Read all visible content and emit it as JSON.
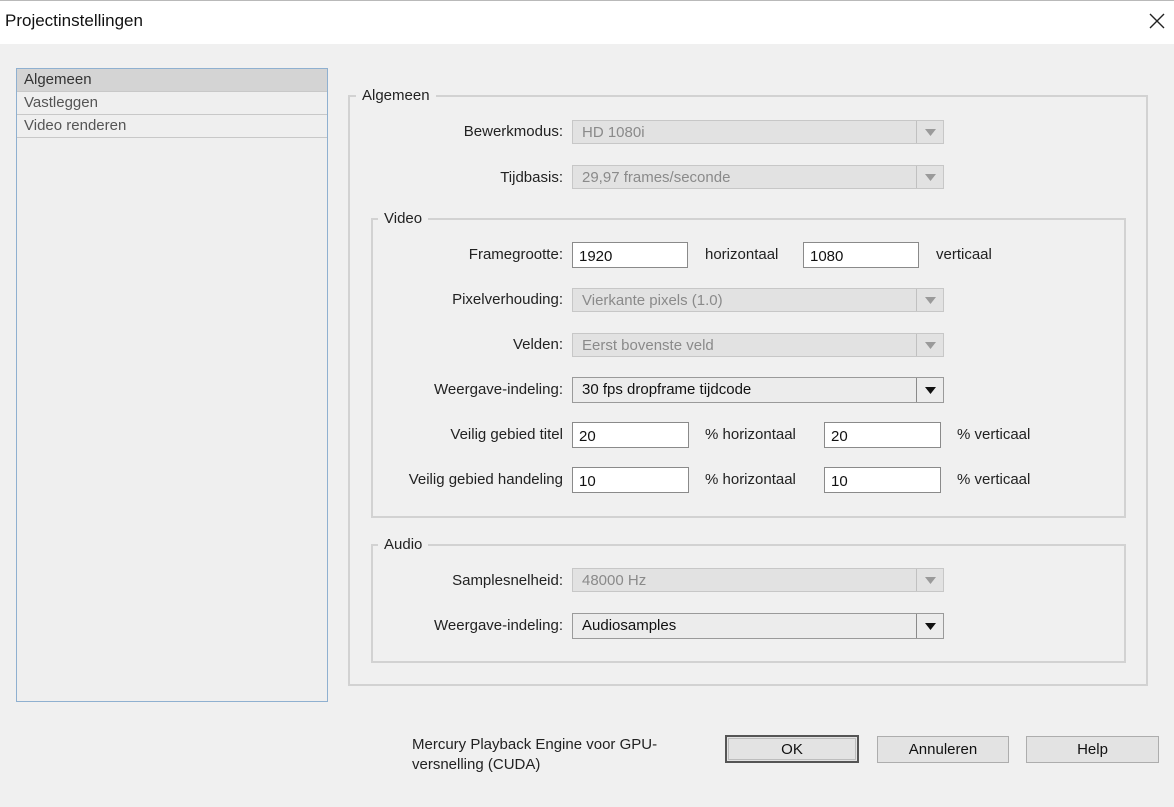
{
  "window": {
    "title": "Projectinstellingen",
    "close_icon": "close-icon"
  },
  "sidebar": {
    "items": [
      {
        "label": "Algemeen",
        "selected": true
      },
      {
        "label": "Vastleggen",
        "selected": false
      },
      {
        "label": "Video renderen",
        "selected": false
      }
    ]
  },
  "general": {
    "legend": "Algemeen",
    "edit_mode": {
      "label": "Bewerkmodus:",
      "value": "HD 1080i",
      "enabled": false
    },
    "timebase": {
      "label": "Tijdbasis:",
      "value": "29,97 frames/seconde",
      "enabled": false
    }
  },
  "video": {
    "legend": "Video",
    "frame_size": {
      "label": "Framegrootte:",
      "horizontal": "1920",
      "horizontal_label": "horizontaal",
      "vertical": "1080",
      "vertical_label": "verticaal"
    },
    "pixel_aspect": {
      "label": "Pixelverhouding:",
      "value": "Vierkante pixels (1.0)",
      "enabled": false
    },
    "fields": {
      "label": "Velden:",
      "value": "Eerst bovenste veld",
      "enabled": false
    },
    "display_format": {
      "label": "Weergave-indeling:",
      "value": "30 fps dropframe tijdcode",
      "enabled": true
    },
    "title_safe": {
      "label": "Veilig gebied titel",
      "horizontal": "20",
      "horizontal_label": "% horizontaal",
      "vertical": "20",
      "vertical_label": "% verticaal"
    },
    "action_safe": {
      "label": "Veilig gebied handeling",
      "horizontal": "10",
      "horizontal_label": "% horizontaal",
      "vertical": "10",
      "vertical_label": "% verticaal"
    }
  },
  "audio": {
    "legend": "Audio",
    "sample_rate": {
      "label": "Samplesnelheid:",
      "value": "48000 Hz",
      "enabled": false
    },
    "display_format": {
      "label": "Weergave-indeling:",
      "value": "Audiosamples",
      "enabled": true
    }
  },
  "footer": {
    "mercury_text": "Mercury Playback Engine voor GPU-versnelling (CUDA)",
    "ok_label": "OK",
    "cancel_label": "Annuleren",
    "help_label": "Help"
  }
}
